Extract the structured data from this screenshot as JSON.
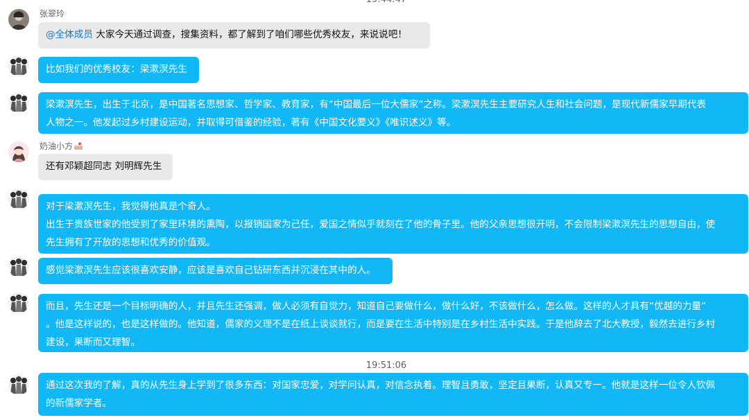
{
  "chat": {
    "timestamps": [
      "19:44:47",
      "19:51:06"
    ],
    "messages": [
      {
        "sender": "张翠玲",
        "avatar": "avatar-photo-dark",
        "mention": "@全体成员",
        "lines": [
          "大家今天通过调查，搜集资料，都了解到了咱们哪些优秀校友，来说说吧！"
        ]
      },
      {
        "sender": "",
        "avatar": "avatar-group-sketch",
        "lines": [
          "比如我们的优秀校友：梁漱溟先生"
        ]
      },
      {
        "sender": "",
        "avatar": "avatar-group-sketch",
        "lines": [
          "梁漱溟先生，出生于北京，是中国著名思想家、哲学家、教育家，有“中国最后一位大儒家”之称。梁漱溟先生主要研究人生和社会问题，是现代新儒家早期代表",
          "人物之一。他发起过乡村建设运动，并取得可借鉴的经验，著有《中国文化要义》《唯识述义》等。"
        ]
      },
      {
        "sender": "奶油小方",
        "avatar": "avatar-girl-cartoon",
        "badge": "cake-icon",
        "lines": [
          "还有邓颖超同志 刘明辉先生"
        ]
      },
      {
        "sender": "",
        "avatar": "avatar-group-sketch",
        "lines": [
          "对于梁漱溟先生，我觉得他真是个奇人。",
          "出生于贵族世家的他受到了家里环境的熏陶，以报销国家为己任，爱国之情似乎就刻在了他的骨子里。他的父亲思想很开明，不会限制梁漱溟先生的思想自由，使",
          "先生拥有了开放的思想和优秀的价值观。"
        ]
      },
      {
        "sender": "",
        "avatar": "avatar-group-sketch",
        "lines": [
          "感觉梁漱溟先生应该很喜欢安静，应该是喜欢自己钻研东西并沉浸在其中的人。"
        ]
      },
      {
        "sender": "",
        "avatar": "avatar-group-sketch",
        "lines": [
          "而且，先生还是一个目标明确的人，并且先生还强调，做人必须有自觉力，知道自己要做什么，做什么好，不该做什么，怎么做。这样的人才具有“优越的力量”",
          "。他是这样说的，也是这样做的。他知道，儒家的义理不是在纸上谈谈就行，而是要在生活中特别是在乡村生活中实践。于是他辞去了北大教授，毅然去进行乡村",
          "建设，果断而又理智。"
        ]
      },
      {
        "sender": "",
        "avatar": "avatar-group-sketch",
        "lines": [
          "通过这次我的了解，真的从先生身上学到了很多东西：对国家忠爱，对学问认真，对信念执着。理智且勇敢，坚定且果断，认真又专一。他就是这样一位令人钦佩",
          "的新儒家学者。"
        ]
      }
    ]
  },
  "colors": {
    "bubble_blue": "#12b7f5",
    "bubble_gray": "#e9e9e9",
    "mention": "#1777d9",
    "timestamp_text": "#5f5f5f"
  }
}
